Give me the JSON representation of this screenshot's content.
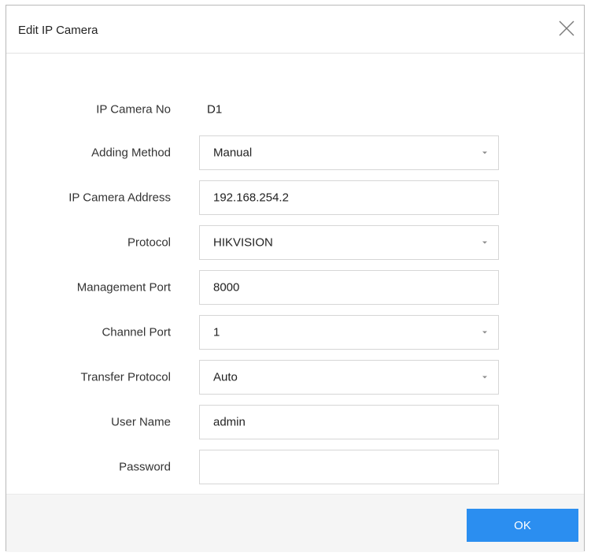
{
  "dialog": {
    "title": "Edit IP Camera",
    "close_icon": "close-icon"
  },
  "form": {
    "camera_no": {
      "label": "IP Camera No",
      "value": "D1"
    },
    "adding_method": {
      "label": "Adding Method",
      "value": "Manual"
    },
    "ip_address": {
      "label": "IP Camera Address",
      "value": "192.168.254.2"
    },
    "protocol": {
      "label": "Protocol",
      "value": "HIKVISION"
    },
    "management_port": {
      "label": "Management Port",
      "value": "8000"
    },
    "channel_port": {
      "label": "Channel Port",
      "value": "1"
    },
    "transfer_protocol": {
      "label": "Transfer Protocol",
      "value": "Auto"
    },
    "user_name": {
      "label": "User Name",
      "value": "admin"
    },
    "password": {
      "label": "Password",
      "value": ""
    }
  },
  "footer": {
    "ok_label": "OK"
  },
  "colors": {
    "accent": "#2b8ef0",
    "border": "#d6d6d6",
    "footer_bg": "#f5f5f5"
  }
}
